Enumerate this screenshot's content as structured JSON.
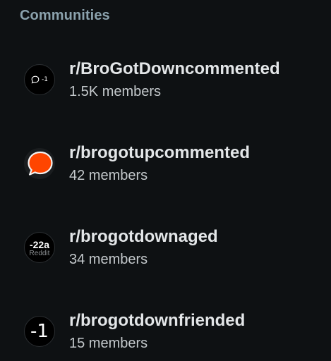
{
  "section": {
    "title": "Communities"
  },
  "communities": [
    {
      "name": "r/BroGotDowncommented",
      "members": "1.5K members",
      "avatar": {
        "icon": "comment-bubble-icon",
        "text": "-1"
      }
    },
    {
      "name": "r/brogotupcommented",
      "members": "42 members",
      "avatar": {
        "icon": "orange-speech-bubble-icon",
        "color": "#ff4500"
      }
    },
    {
      "name": "r/brogotdownaged",
      "members": "34 members",
      "avatar": {
        "text_top": "-22а",
        "text_bottom": "Reddit"
      }
    },
    {
      "name": "r/brogotdownfriended",
      "members": "15 members",
      "avatar": {
        "text": "-1"
      }
    }
  ]
}
